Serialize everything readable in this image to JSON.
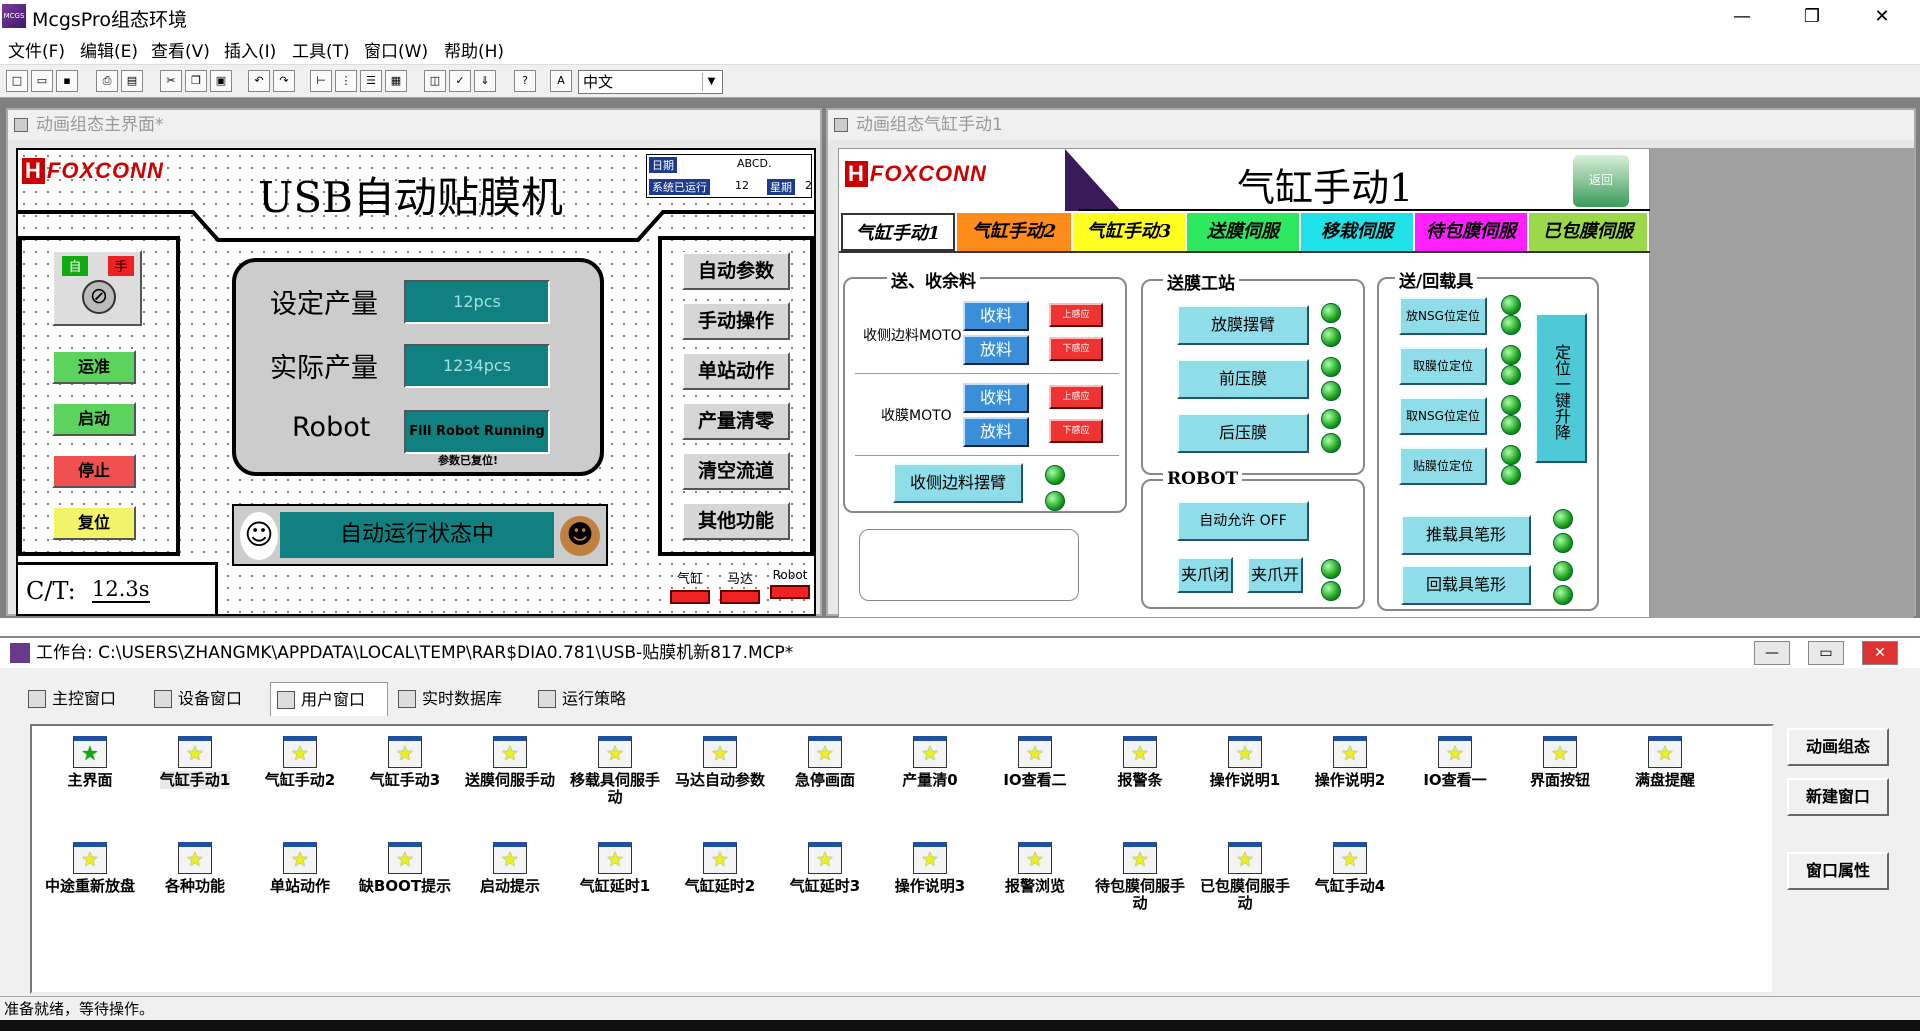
{
  "app": {
    "title": "McgsPro组态环境",
    "icon_label": "MCGS"
  },
  "window_controls": {
    "minimize": "—",
    "restore": "❐",
    "close": "✕"
  },
  "menus": [
    "文件(F)",
    "编辑(E)",
    "查看(V)",
    "插入(I)",
    "工具(T)",
    "窗口(W)",
    "帮助(H)"
  ],
  "toolbar": {
    "language": "中文"
  },
  "main_window": {
    "title": "动画组态主界面*",
    "logo": "FOXCONN",
    "heading": "USB自动贴膜机",
    "info": {
      "date_label": "日期",
      "date_value": "ABCD.",
      "uptime_label": "系统已运行",
      "uptime_value": "12",
      "weekday_label": "星期",
      "weekday_value": "2"
    },
    "mode_auto": "自",
    "mode_manual": "手",
    "left_buttons": [
      "运准",
      "启动",
      "停止",
      "复位"
    ],
    "counters": [
      {
        "label": "设定产量",
        "value": "12pcs"
      },
      {
        "label": "实际产量",
        "value": "1234pcs"
      },
      {
        "label": "Robot",
        "value": "Fill Robot Running"
      }
    ],
    "reset_note": "参数已复位!",
    "ticker": "自动运行状态中",
    "ct_label": "C/T:",
    "ct_value": "12.3s",
    "right_buttons": [
      "自动参数",
      "手动操作",
      "单站动作",
      "产量清零",
      "清空流道",
      "其他功能"
    ],
    "alarms": [
      "气缸",
      "马达",
      "Robot"
    ]
  },
  "cyl_window": {
    "title": "动画组态气缸手动1",
    "logo": "FOXCONN",
    "heading": "气缸手动1",
    "back_label": "返回",
    "tabs": [
      {
        "label": "气缸手动1",
        "color": "#ffffff"
      },
      {
        "label": "气缸手动2",
        "color": "#ff8c1a"
      },
      {
        "label": "气缸手动3",
        "color": "#ffff20"
      },
      {
        "label": "送膜伺服",
        "color": "#2ee860"
      },
      {
        "label": "移栽伺服",
        "color": "#20e0e8"
      },
      {
        "label": "待包膜伺服",
        "color": "#ff20ff"
      },
      {
        "label": "已包膜伺服",
        "color": "#9bd84a"
      }
    ],
    "group1": {
      "title": "送、收余料",
      "row1_label": "收侧边料MOTO",
      "row2_label": "收膜MOTO",
      "collect": "收料",
      "release": "放料",
      "limit_up": "上感应",
      "limit_down": "下感应",
      "swing": "收侧边料摆臂"
    },
    "group2": {
      "title": "送膜工站",
      "buttons": [
        "放膜摆臂",
        "前压膜",
        "后压膜"
      ]
    },
    "group3": {
      "title": "ROBOT",
      "auto_allow": "自动允许 OFF",
      "clamp_close": "夹爪闭",
      "clamp_open": "夹爪开"
    },
    "group4": {
      "title": "送/回载具",
      "buttons": [
        "放NSG位定位",
        "取膜位定位",
        "取NSG位定位",
        "贴膜位定位"
      ],
      "lift": "定位一键升降",
      "push": "推载具笔形",
      "return": "回载具笔形"
    }
  },
  "workbench": {
    "title": "工作台: C:\\USERS\\ZHANGMK\\APPDATA\\LOCAL\\TEMP\\RAR$DIA0.781\\USB-贴膜机新817.MCP*",
    "tabs": [
      "主控窗口",
      "设备窗口",
      "用户窗口",
      "实时数据库",
      "运行策略"
    ],
    "items_row1": [
      "主界面",
      "气缸手动1",
      "气缸手动2",
      "气缸手动3",
      "送膜伺服手动",
      "移载具伺服手动",
      "马达自动参数",
      "急停画面",
      "产量清0",
      "IO查看二",
      "报警条",
      "操作说明1",
      "操作说明2",
      "IO查看一",
      "界面按钮",
      "满盘提醒"
    ],
    "items_row2": [
      "中途重新放盘",
      "各种功能",
      "单站动作",
      "缺BOOT提示",
      "启动提示",
      "气缸延时1",
      "气缸延时2",
      "气缸延时3",
      "操作说明3",
      "报警浏览",
      "待包膜伺服手动",
      "已包膜伺服手动",
      "气缸手动4"
    ],
    "side_buttons": [
      "动画组态",
      "新建窗口",
      "窗口属性"
    ]
  },
  "status": "准备就绪，等待操作。"
}
